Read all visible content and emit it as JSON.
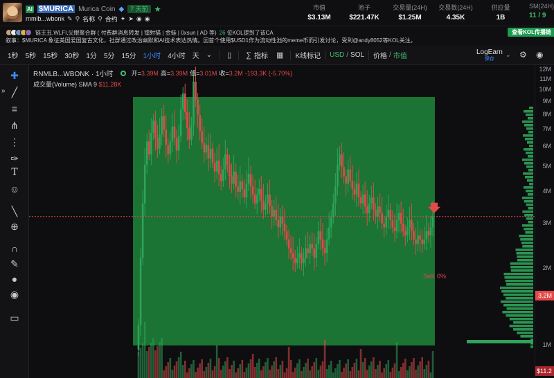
{
  "header": {
    "ai_badge": "AI",
    "symbol": "$MURICA",
    "coin_name": "Murica Coin",
    "age": "7 天前",
    "contract_short": "rnmlb...wbonk",
    "name_label": "名称",
    "contract_label": "合约",
    "stats": [
      {
        "label": "市值",
        "value": "$3.13M"
      },
      {
        "label": "池子",
        "value": "$221.47K"
      },
      {
        "label": "交易量(24H)",
        "value": "$1.25M"
      },
      {
        "label": "交易数(24H)",
        "value": "4.35K"
      },
      {
        "label": "供应量",
        "value": "1B"
      },
      {
        "label": "SM(24H)",
        "value": "11 / 9"
      }
    ]
  },
  "kol": {
    "names": "链王丑,WLFI,尖眼聚合群 ( 付费群消息转发 | 镭射猫 | 金蛙 | 0xsun | AD 等)",
    "count": "26",
    "suffix": "位KOL提到了该CA",
    "button": "查看KOL传播链"
  },
  "narrative": "叙事：$MURICA 象征美国爱国复古文化，社群通过政治幽默和AI技术表达热情。因首个使用$USD1作为流动性池的meme币而引发讨论，受到@andy8052等KOL关注。",
  "toolbar": {
    "timeframes": [
      "1秒",
      "5秒",
      "15秒",
      "30秒",
      "1分",
      "5分",
      "15分",
      "1小时",
      "4小时",
      "天"
    ],
    "active_timeframe": "1小时",
    "indicator_label": "指标",
    "kline_mark_label": "K线标记",
    "usd_label": "USD",
    "sol_label": "SOL",
    "price_label": "价格",
    "mcap_label": "市值",
    "logearn_label": "LogEarn",
    "logearn_sub": "保存"
  },
  "legend": {
    "pair": "RNMLB...WBONK · 1小时",
    "open_label": "开=",
    "open": "3.39M",
    "high_label": "高=",
    "high": "3.39M",
    "low_label": "低=",
    "low": "3.01M",
    "close_label": "收=",
    "close": "3.2M",
    "change": "-193.3K (-5.70%)",
    "volume_label": "成交量(Volume) SMA 9",
    "volume_value": "$11.28K"
  },
  "sell_marker": "Sell: 0%",
  "colors": {
    "up": "#2fa35a",
    "down": "#e54848",
    "highlight": "#1f8f3f",
    "accent": "#3b8bff"
  },
  "chart_data": {
    "type": "candlestick",
    "x_unit": "1小时 candles",
    "y_unit": "market cap (USD)",
    "yscale": "log",
    "ylim": [
      1000000,
      12500000
    ],
    "y_ticks": [
      "12M",
      "11M",
      "10M",
      "9M",
      "8M",
      "7M",
      "6M",
      "5M",
      "4M",
      "3M",
      "2M",
      "1M"
    ],
    "last_price_label": "3.2M",
    "last_volume_label": "$11.2",
    "close_series": [
      1.2,
      2.2,
      3.6,
      5.1,
      6.3,
      5.6,
      6.8,
      7.6,
      6.5,
      5.9,
      6.7,
      7.9,
      7.0,
      6.1,
      5.6,
      6.3,
      7.2,
      6.5,
      5.8,
      6.6,
      8.4,
      9.7,
      8.2,
      7.1,
      6.4,
      7.3,
      10.8,
      9.2,
      8.0,
      6.9,
      6.2,
      5.7,
      6.1,
      5.4,
      5.9,
      5.2,
      4.8,
      5.3,
      4.7,
      4.4,
      4.9,
      5.6,
      5.1,
      4.6,
      4.3,
      4.8,
      4.2,
      4.0,
      4.4,
      4.1,
      3.8,
      4.3,
      4.7,
      4.2,
      3.9,
      3.6,
      3.9,
      4.1,
      3.7,
      3.4,
      3.6,
      3.9,
      3.5,
      3.2,
      3.4,
      3.1,
      2.9,
      3.2,
      3.0,
      2.8,
      2.6,
      2.4,
      2.3,
      2.2,
      2.1,
      2.2,
      2.3,
      2.1,
      2.2,
      2.4,
      2.3,
      2.5,
      2.4,
      2.2,
      2.5,
      2.8,
      2.6,
      2.4,
      2.3,
      2.6,
      2.9,
      3.2,
      3.6,
      4.2,
      5.1,
      5.6,
      5.0,
      4.6,
      4.3,
      4.9,
      4.4,
      4.1,
      3.9,
      4.3,
      3.8,
      3.6,
      3.9,
      3.5,
      3.3,
      3.6,
      3.8,
      3.4,
      3.2,
      3.5,
      3.3,
      3.0,
      2.9,
      3.2,
      3.4,
      3.1,
      2.9,
      2.8,
      3.1,
      3.3,
      3.0,
      2.8,
      2.7,
      2.9,
      3.1,
      2.8,
      2.6,
      2.5,
      2.7,
      2.6,
      2.5,
      2.6,
      2.8,
      2.7,
      2.9,
      3.2
    ]
  }
}
